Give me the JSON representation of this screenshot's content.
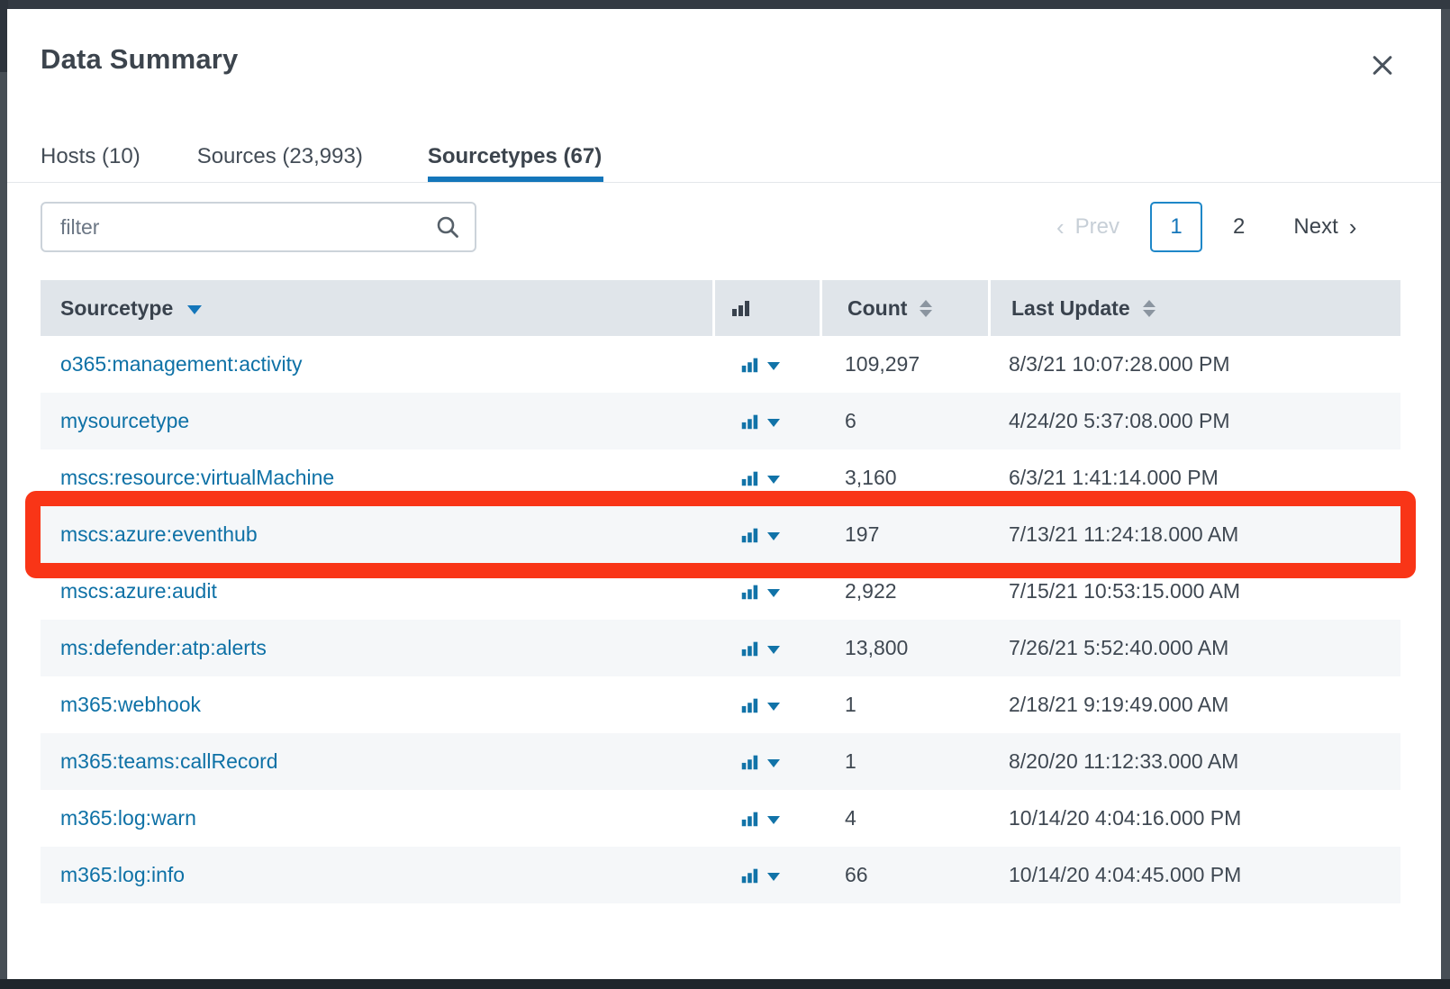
{
  "modal": {
    "title": "Data Summary"
  },
  "tabs": [
    {
      "label": "Hosts (10)",
      "active": false
    },
    {
      "label": "Sources (23,993)",
      "active": false
    },
    {
      "label": "Sourcetypes (67)",
      "active": true
    }
  ],
  "filter": {
    "placeholder": "filter",
    "value": ""
  },
  "pagination": {
    "prev_label": "Prev",
    "prev_chevron": "‹",
    "pages": [
      "1",
      "2"
    ],
    "current_page": "1",
    "next_label": "Next",
    "next_chevron": "›"
  },
  "table": {
    "columns": [
      {
        "label": "Sourcetype",
        "sort": "descending",
        "sort_icon": "caret-down-icon"
      },
      {
        "label": "",
        "icon": "bar-chart-icon"
      },
      {
        "label": "Count",
        "sort_icon": "sort-toggle-icon"
      },
      {
        "label": "Last Update",
        "sort_icon": "sort-toggle-icon"
      }
    ],
    "rows": [
      {
        "sourcetype": "o365:management:activity",
        "count": "109,297",
        "last_update": "8/3/21 10:07:28.000 PM"
      },
      {
        "sourcetype": "mysourcetype",
        "count": "6",
        "last_update": "4/24/20 5:37:08.000 PM"
      },
      {
        "sourcetype": "mscs:resource:virtualMachine",
        "count": "3,160",
        "last_update": "6/3/21 1:41:14.000 PM"
      },
      {
        "sourcetype": "mscs:azure:eventhub",
        "count": "197",
        "last_update": "7/13/21 11:24:18.000 AM",
        "highlighted": true
      },
      {
        "sourcetype": "mscs:azure:audit",
        "count": "2,922",
        "last_update": "7/15/21 10:53:15.000 AM"
      },
      {
        "sourcetype": "ms:defender:atp:alerts",
        "count": "13,800",
        "last_update": "7/26/21 5:52:40.000 AM"
      },
      {
        "sourcetype": "m365:webhook",
        "count": "1",
        "last_update": "2/18/21 9:19:49.000 AM"
      },
      {
        "sourcetype": "m365:teams:callRecord",
        "count": "1",
        "last_update": "8/20/20 11:12:33.000 AM"
      },
      {
        "sourcetype": "m365:log:warn",
        "count": "4",
        "last_update": "10/14/20 4:04:16.000 PM"
      },
      {
        "sourcetype": "m365:log:info",
        "count": "66",
        "last_update": "10/14/20 4:04:45.000 PM"
      }
    ]
  },
  "annotation": {
    "type": "highlight-box",
    "target_row": "mscs:azure:eventhub",
    "color": "#f93517"
  },
  "icons": {
    "close": "close-icon",
    "search": "search-icon",
    "row_chart": "bar-chart-icon",
    "row_menu": "caret-down-icon",
    "sort_desc": "caret-down-icon",
    "sort_toggle": "sort-toggle-icon"
  },
  "colors": {
    "link_blue": "#0e71a6",
    "accent_blue": "#1476ba",
    "page_border_blue": "#1e87c8",
    "header_bg": "#e0e5ea",
    "alt_row_bg": "#f5f7f9",
    "text_dark": "#3c444d",
    "placeholder_gray": "#6b7684",
    "disabled_gray": "#c7cfd7",
    "annotation_red": "#f93517",
    "frame_dark": "#474e55"
  }
}
